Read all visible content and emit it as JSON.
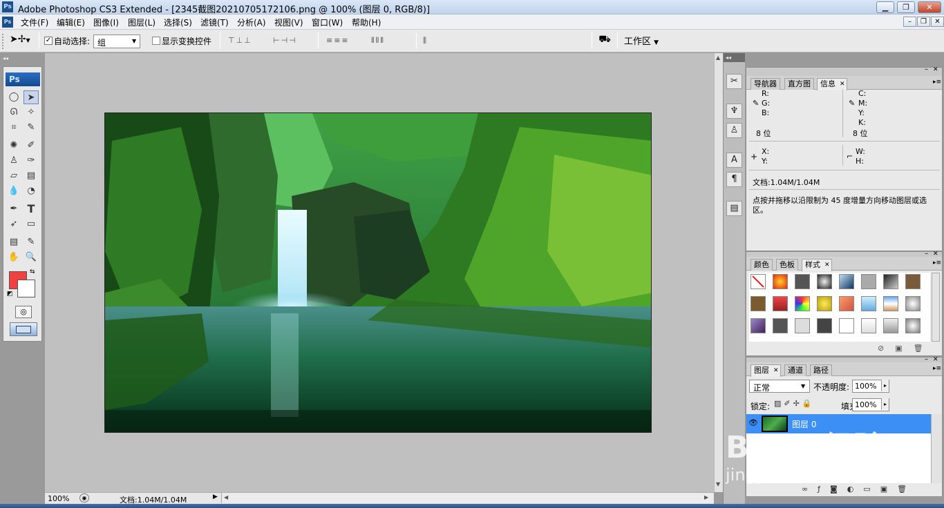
{
  "window": {
    "title": "Adobe Photoshop CS3 Extended - [2345截图20210705172106.png @ 100% (图层 0, RGB/8)]",
    "app_icon": "Ps"
  },
  "window_buttons": [
    "minimize-icon",
    "restore-icon",
    "close-icon"
  ],
  "menu": [
    "文件(F)",
    "编辑(E)",
    "图像(I)",
    "图层(L)",
    "选择(S)",
    "滤镜(T)",
    "分析(A)",
    "视图(V)",
    "窗口(W)",
    "帮助(H)"
  ],
  "options": {
    "auto_select_label": "自动选择:",
    "auto_select_value": "组",
    "show_transform_label": "显示变换控件",
    "workspace_label": "工作区"
  },
  "toolbox": {
    "logo": "Ps",
    "fg_color": "#f04040",
    "bg_color": "#ffffff"
  },
  "status": {
    "zoom": "100%",
    "doc_info": "文档:1.04M/1.04M"
  },
  "info_panel": {
    "tabs": [
      "导航器",
      "直方图",
      "信息"
    ],
    "active_tab": "信息",
    "rgb_labels": [
      "R:",
      "G:",
      "B:"
    ],
    "cmyk_labels": [
      "C:",
      "M:",
      "Y:",
      "K:"
    ],
    "bit_left": "8 位",
    "bit_right": "8 位",
    "xy_labels": [
      "X:",
      "Y:"
    ],
    "wh_labels": [
      "W:",
      "H:"
    ],
    "doc": "文档:1.04M/1.04M",
    "hint": "点按并拖移以沿限制为 45 度增量方向移动图层或选区。"
  },
  "styles_panel": {
    "tabs": [
      "颜色",
      "色板",
      "样式"
    ],
    "active_tab": "样式"
  },
  "layers_panel": {
    "tabs": [
      "图层",
      "通道",
      "路径"
    ],
    "active_tab": "图层",
    "blend_mode": "正常",
    "opacity_label": "不透明度:",
    "opacity_value": "100%",
    "lock_label": "锁定:",
    "fill_label": "填充:",
    "fill_value": "100%",
    "layers": [
      {
        "name": "图层 0"
      }
    ]
  },
  "watermark": {
    "brand": "Baidu经验",
    "url": "jingyan.baidu.com"
  }
}
